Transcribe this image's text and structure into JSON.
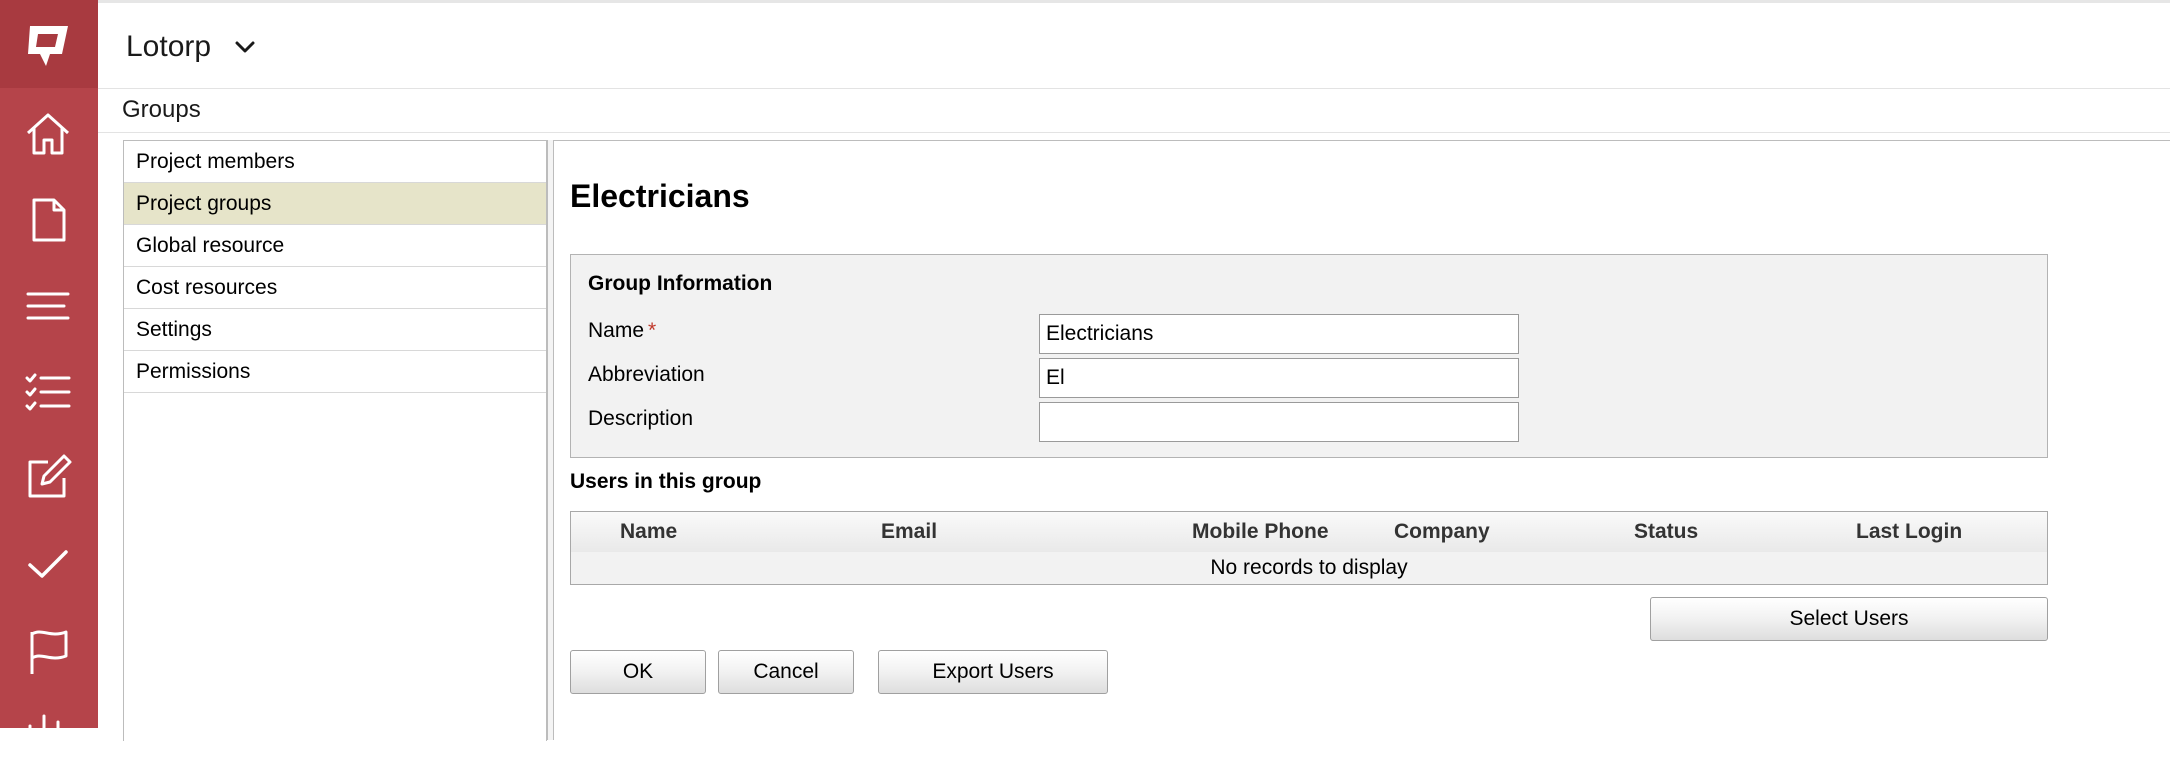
{
  "header": {
    "project_name": "Lotorp"
  },
  "breadcrumb": "Groups",
  "sidebar": {
    "items": [
      {
        "label": "Project members"
      },
      {
        "label": "Project groups"
      },
      {
        "label": "Global resource"
      },
      {
        "label": "Cost resources"
      },
      {
        "label": "Settings"
      },
      {
        "label": "Permissions"
      }
    ]
  },
  "group": {
    "title": "Electricians",
    "info_heading": "Group Information",
    "fields": {
      "name_label": "Name",
      "name_required": "*",
      "name_value": "Electricians",
      "abbreviation_label": "Abbreviation",
      "abbreviation_value": "El",
      "description_label": "Description",
      "description_value": ""
    }
  },
  "users": {
    "heading": "Users in this group",
    "columns": [
      "Name",
      "Email",
      "Mobile Phone",
      "Company",
      "Status",
      "Last Login"
    ],
    "empty_text": "No records to display",
    "select_users_label": "Select Users"
  },
  "actions": {
    "ok_label": "OK",
    "cancel_label": "Cancel",
    "export_label": "Export Users"
  },
  "colors": {
    "rail": "#b5444a",
    "active_menu": "#e6e4c9",
    "required": "#c0392b"
  }
}
